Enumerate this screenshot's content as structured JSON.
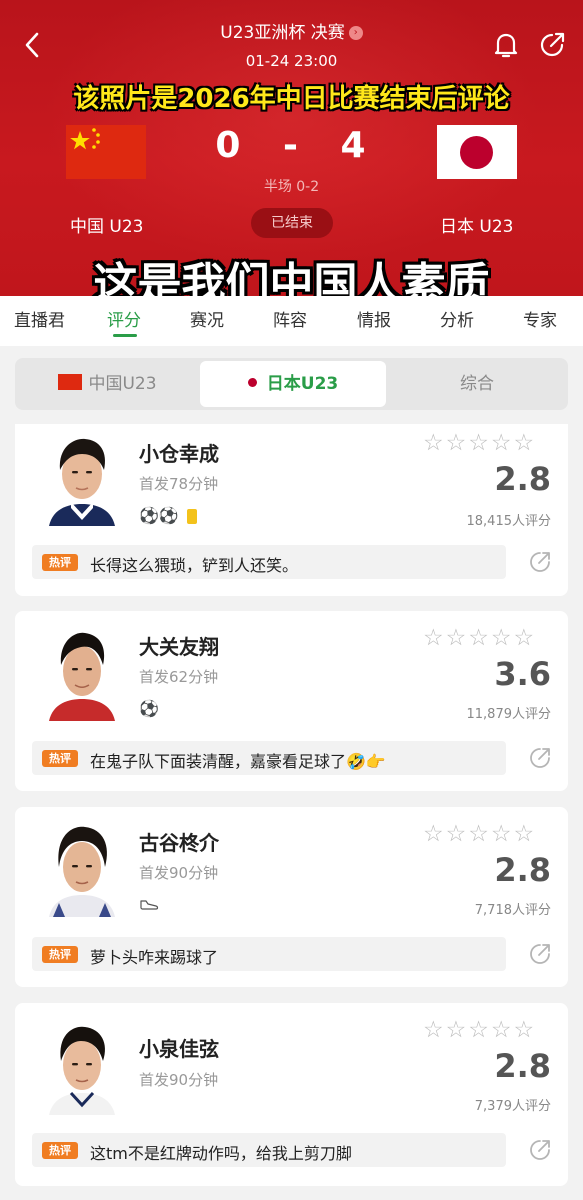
{
  "header": {
    "competition": "U23亚洲杯 决赛",
    "match_time": "01-24 23:00",
    "overlay_caption_1": "该照片是2026年中日比赛结束后评论",
    "overlay_caption_2": "这是我们中国人素质",
    "home_score": "0",
    "score_sep": "-",
    "away_score": "4",
    "halftime": "半场 0-2",
    "home_team": "中国 U23",
    "away_team": "日本 U23",
    "status": "已结束",
    "colors": {
      "header_red": "#c0161c",
      "caption_yellow": "#ffe81a"
    }
  },
  "tabs": [
    "直播君",
    "评分",
    "赛况",
    "阵容",
    "情报",
    "分析",
    "专家"
  ],
  "active_tab": "评分",
  "team_switch": {
    "items": [
      "中国U23",
      "日本U23",
      "综合"
    ],
    "selected": "日本U23"
  },
  "players": [
    {
      "name": "小仓幸成",
      "minutes": "首发78分钟",
      "events": "⚽⚽",
      "yellow_card": true,
      "rating": "2.8",
      "rating_count": "18,415人评分",
      "hot_label": "热评",
      "comment": "长得这么猥琐，铲到人还笑。"
    },
    {
      "name": "大关友翔",
      "minutes": "首发62分钟",
      "events": "⚽",
      "yellow_card": false,
      "rating": "3.6",
      "rating_count": "11,879人评分",
      "hot_label": "热评",
      "comment": "在鬼子队下面装清醒，嘉豪看足球了🤣👉"
    },
    {
      "name": "古谷柊介",
      "minutes": "首发90分钟",
      "events": "boot-icon",
      "yellow_card": false,
      "rating": "2.8",
      "rating_count": "7,718人评分",
      "hot_label": "热评",
      "comment": "萝卜头咋来踢球了"
    },
    {
      "name": "小泉佳弦",
      "minutes": "首发90分钟",
      "events": "",
      "yellow_card": false,
      "rating": "2.8",
      "rating_count": "7,379人评分",
      "hot_label": "热评",
      "comment": "这tm不是红牌动作吗，给我上剪刀脚"
    }
  ],
  "accent_green": "#2a9d48",
  "hot_orange": "#f07d22"
}
